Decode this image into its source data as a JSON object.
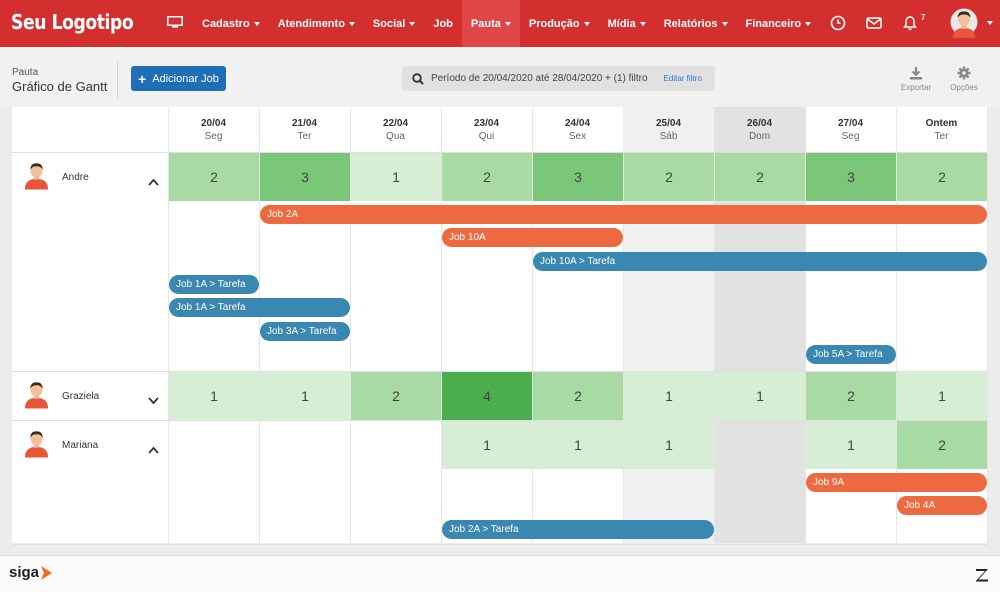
{
  "brand": {
    "logo_text": "Seu Logotipo",
    "accent": "#d32f2f",
    "footer_brand": "siga"
  },
  "nav": [
    {
      "label": "Cadastro",
      "caret": true,
      "active": false
    },
    {
      "label": "Atendimento",
      "caret": true,
      "active": false
    },
    {
      "label": "Social",
      "caret": true,
      "active": false
    },
    {
      "label": "Job",
      "caret": false,
      "active": false
    },
    {
      "label": "Pauta",
      "caret": true,
      "active": true
    },
    {
      "label": "Produção",
      "caret": true,
      "active": false
    },
    {
      "label": "Mídia",
      "caret": true,
      "active": false
    },
    {
      "label": "Relatórios",
      "caret": true,
      "active": false
    },
    {
      "label": "Financeiro",
      "caret": true,
      "active": false
    }
  ],
  "notifications": {
    "count": "7"
  },
  "toolbar": {
    "breadcrumb_small": "Pauta",
    "page_title": "Gráfico de Gantt",
    "add_button": "Adicionar Job",
    "filter_text": "Período de 20/04/2020 até 28/04/2020 + (1) filtro",
    "filter_edit": "Editar filtro",
    "export_label": "Exportar",
    "options_label": "Opções"
  },
  "days": [
    {
      "date": "20/04",
      "weekday": "Seg",
      "weekend": false
    },
    {
      "date": "21/04",
      "weekday": "Ter",
      "weekend": false
    },
    {
      "date": "22/04",
      "weekday": "Qua",
      "weekend": false
    },
    {
      "date": "23/04",
      "weekday": "Qui",
      "weekend": false
    },
    {
      "date": "24/04",
      "weekday": "Sex",
      "weekend": false
    },
    {
      "date": "25/04",
      "weekday": "Sáb",
      "weekend": "sat"
    },
    {
      "date": "26/04",
      "weekday": "Dom",
      "weekend": "sun"
    },
    {
      "date": "27/04",
      "weekday": "Seg",
      "weekend": false
    },
    {
      "date": "Ontem",
      "weekday": "Ter",
      "weekend": false
    }
  ],
  "people": [
    {
      "name": "Andre",
      "expanded": true,
      "counts": [
        2,
        3,
        1,
        2,
        3,
        2,
        2,
        3,
        2
      ],
      "tasks": [
        {
          "label": "Job 2A",
          "start": 1,
          "end": 9,
          "color": "orange"
        },
        {
          "label": "Job 10A",
          "start": 3,
          "end": 5,
          "color": "orange"
        },
        {
          "label": "Job 10A > Tarefa",
          "start": 4,
          "end": 9,
          "color": "blue"
        },
        {
          "label": "Job 1A > Tarefa",
          "start": 0,
          "end": 1,
          "color": "blue"
        },
        {
          "label": "Job 1A > Tarefa",
          "start": 0,
          "end": 2,
          "color": "blue"
        },
        {
          "label": "Job 3A > Tarefa",
          "start": 1,
          "end": 2,
          "color": "blue"
        },
        {
          "label": "Job 5A > Tarefa",
          "start": 7,
          "end": 8,
          "color": "blue"
        }
      ]
    },
    {
      "name": "Graziela",
      "expanded": false,
      "counts": [
        1,
        1,
        2,
        4,
        2,
        1,
        1,
        2,
        1
      ],
      "tasks": []
    },
    {
      "name": "Mariana",
      "expanded": true,
      "counts": [
        null,
        null,
        null,
        1,
        1,
        1,
        null,
        1,
        2
      ],
      "tasks": [
        {
          "label": "Job 9A",
          "start": 7,
          "end": 9,
          "color": "orange"
        },
        {
          "label": "Job 4A",
          "start": 8,
          "end": 9,
          "color": "orange"
        },
        {
          "label": "Job 2A > Tarefa",
          "start": 3,
          "end": 6,
          "color": "blue"
        }
      ]
    }
  ],
  "colors": {
    "count_1": "#d6efd4",
    "count_2": "#a8dba4",
    "count_3": "#7bc779",
    "count_4": "#4cad4c",
    "bar_orange": "#ed6a41",
    "bar_blue": "#3a87b1",
    "saturday": "#f0f0f0",
    "sunday": "#e2e2e2"
  }
}
